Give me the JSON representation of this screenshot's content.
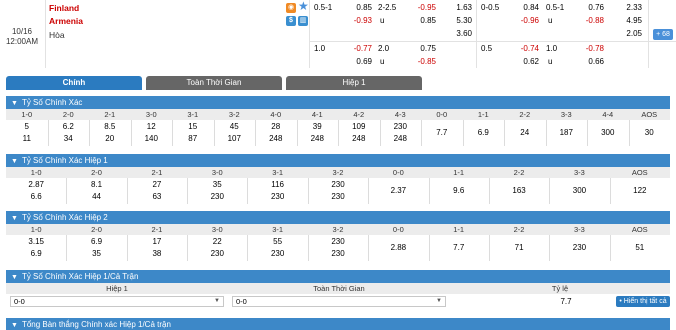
{
  "match": {
    "date": "10/16",
    "time": "12:00AM",
    "home": "Finland",
    "away": "Armenia",
    "draw": "Hòa",
    "more_count": "+ 68",
    "line1": {
      "ft_hdp": "0.5-1",
      "ft_h1": "0.85",
      "ft_ou": "2-2.5",
      "ft_o1": "-0.95",
      "ft_1x2_1": "1.63",
      "h1_hdp": "0-0.5",
      "h1_h1": "0.84",
      "h1_ou": "0.5-1",
      "h1_o1": "0.76",
      "h1_1x2_1": "2.33"
    },
    "line2": {
      "ft_h2": "-0.93",
      "ft_u": "u",
      "ft_o2": "0.85",
      "ft_1x2_2": "5.30",
      "h1_h2": "-0.96",
      "h1_u": "u",
      "h1_o2": "-0.88",
      "h1_1x2_2": "4.95"
    },
    "line3": {
      "ft_1x2_x": "3.60",
      "h1_1x2_x": "2.05"
    },
    "line4": {
      "ft_hdp": "1.0",
      "ft_h1": "-0.77",
      "ft_ou": "2.0",
      "ft_o1": "0.75",
      "h1_hdp": "0.5",
      "h1_h1": "-0.74",
      "h1_ou": "1.0",
      "h1_o1": "-0.78"
    },
    "line5": {
      "ft_h2": "0.69",
      "ft_u": "u",
      "ft_o2": "-0.85",
      "h1_h2": "0.62",
      "h1_u": "u",
      "h1_o2": "0.66"
    }
  },
  "tabs": [
    "Chính",
    "Toàn Thời Gian",
    "Hiệp 1"
  ],
  "sections": {
    "exact": {
      "title": "Tỷ Số Chính Xác",
      "headers": [
        "1-0",
        "2-0",
        "2-1",
        "3-0",
        "3-1",
        "3-2",
        "4-0",
        "4-1",
        "4-2",
        "4-3",
        "0-0",
        "1-1",
        "2-2",
        "3-3",
        "4-4",
        "AOS"
      ],
      "row1": [
        "5",
        "6.2",
        "8.5",
        "12",
        "15",
        "45",
        "28",
        "39",
        "109",
        "230"
      ],
      "row2": [
        "11",
        "34",
        "20",
        "140",
        "87",
        "107",
        "248",
        "248",
        "248",
        "248"
      ],
      "singles": [
        "7.7",
        "6.9",
        "24",
        "187",
        "300",
        "30"
      ]
    },
    "h1": {
      "title": "Tỷ Số Chính Xác Hiệp 1",
      "headers": [
        "1-0",
        "2-0",
        "2-1",
        "3-0",
        "3-1",
        "3-2",
        "0-0",
        "1-1",
        "2-2",
        "3-3",
        "AOS"
      ],
      "row1": [
        "2.87",
        "8.1",
        "27",
        "35",
        "116",
        "230"
      ],
      "row2": [
        "6.6",
        "44",
        "63",
        "230",
        "230",
        "230"
      ],
      "singles": [
        "2.37",
        "9.6",
        "163",
        "300",
        "122"
      ]
    },
    "h2": {
      "title": "Tỷ Số Chính Xác Hiệp 2",
      "headers": [
        "1-0",
        "2-0",
        "2-1",
        "3-0",
        "3-1",
        "3-2",
        "0-0",
        "1-1",
        "2-2",
        "3-3",
        "AOS"
      ],
      "row1": [
        "3.15",
        "6.9",
        "17",
        "22",
        "55",
        "230"
      ],
      "row2": [
        "6.9",
        "35",
        "38",
        "230",
        "230",
        "230"
      ],
      "singles": [
        "2.88",
        "7.7",
        "71",
        "230",
        "51"
      ]
    },
    "htft": {
      "title": "Tỷ Số Chính Xác Hiệp 1/Cả Trận",
      "col_h1": "Hiệp 1",
      "col_ft": "Toàn Thời Gian",
      "col_ratio": "Tỷ lệ",
      "sel_h1": "0-0",
      "sel_ft": "0-0",
      "ratio": "7.7",
      "view_all": "• Hiển thị tất cả"
    },
    "total": {
      "title": "Tổng Bàn thắng Chính xác Hiệp 1/Cả trận"
    }
  },
  "colors": {
    "accent": "#2b7bc0",
    "section": "#3d88c8",
    "negative": "#cc0000"
  }
}
